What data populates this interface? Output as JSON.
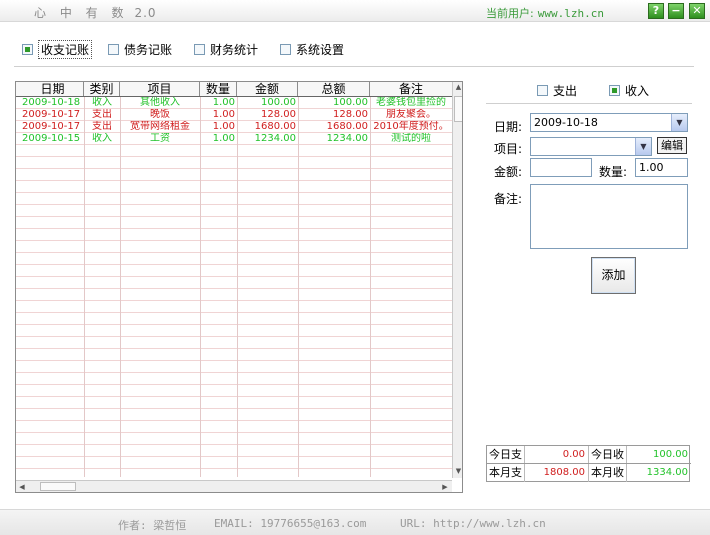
{
  "window": {
    "title": "心 中 有 数",
    "version": "2.0",
    "current_user_label": "当前用户:",
    "current_user_value": "www.lzh.cn",
    "btn_help": "?",
    "btn_min": "−",
    "btn_close": "✕"
  },
  "nav": {
    "income_expense": "收支记账",
    "debt": "债务记账",
    "stats": "财务统计",
    "settings": "系统设置",
    "active": "income_expense"
  },
  "grid": {
    "headers": [
      "日期",
      "类别",
      "项目",
      "数量",
      "金额",
      "总额",
      "备注"
    ],
    "rows": [
      {
        "date": "2009-10-18",
        "category": "收入",
        "item": "其他收入",
        "qty": "1.00",
        "amount": "100.00",
        "total": "100.00",
        "note": "老婆钱包里捡的",
        "type": "income"
      },
      {
        "date": "2009-10-17",
        "category": "支出",
        "item": "晚饭",
        "qty": "1.00",
        "amount": "128.00",
        "total": "128.00",
        "note": "朋友聚会。",
        "type": "expense"
      },
      {
        "date": "2009-10-17",
        "category": "支出",
        "item": "宽带网络租金",
        "qty": "1.00",
        "amount": "1680.00",
        "total": "1680.00",
        "note": "2010年度预付。",
        "type": "expense"
      },
      {
        "date": "2009-10-15",
        "category": "收入",
        "item": "工资",
        "qty": "1.00",
        "amount": "1234.00",
        "total": "1234.00",
        "note": "测试的啦",
        "type": "income"
      }
    ]
  },
  "form": {
    "type_expense": "支出",
    "type_income": "收入",
    "selected_type": "income",
    "date_label": "日期:",
    "date_value": "2009-10-18",
    "item_label": "项目:",
    "item_value": "",
    "edit_button": "编辑",
    "amount_label": "金额:",
    "amount_value": "",
    "qty_label": "数量:",
    "qty_value": "1.00",
    "note_label": "备注:",
    "add_button": "添加"
  },
  "summary": {
    "today_expense_label": "今日支",
    "today_expense_value": "0.00",
    "today_income_label": "今日收",
    "today_income_value": "100.00",
    "month_expense_label": "本月支",
    "month_expense_value": "1808.00",
    "month_income_label": "本月收",
    "month_income_value": "1334.00"
  },
  "footer": {
    "author": "作者: 梁哲恒",
    "email": "EMAIL: 19776655@163.com",
    "url": "URL: http://www.lzh.cn"
  },
  "colors": {
    "income": "#22c22a",
    "expense": "#d01e1e",
    "titlebar_button": "#2e8f1e"
  }
}
